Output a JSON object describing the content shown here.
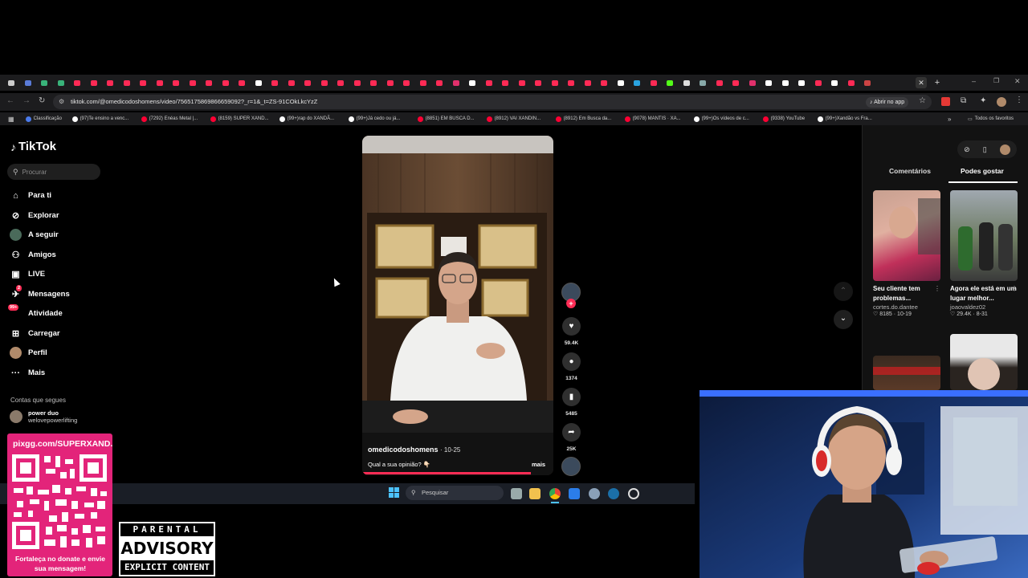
{
  "browser": {
    "url": "tiktok.com/@omedicodoshomens/video/7565175869866659092?_r=1&_t=ZS-91COkLkcYzZ",
    "open_in_app_label": "Abrir no app",
    "bookmarks": [
      {
        "label": "Classificação",
        "color": "#4b7bec"
      },
      {
        "label": "(97)Te ensino a venc...",
        "color": "#ffffff"
      },
      {
        "label": "(7292) Enéas Metal |...",
        "color": "#ff0033"
      },
      {
        "label": "(8159) SUPER XAND...",
        "color": "#ff0033"
      },
      {
        "label": "(99+)rap do XANDÃ...",
        "color": "#ffffff"
      },
      {
        "label": "(99+)Já cedo ou já...",
        "color": "#ffffff"
      },
      {
        "label": "(8851) EM BUSCA D...",
        "color": "#ff0033"
      },
      {
        "label": "(8912) VAI XANDIN...",
        "color": "#ff0033"
      },
      {
        "label": "(8912) Em Busca da...",
        "color": "#ff0033"
      },
      {
        "label": "(9078) MANTIS · XA...",
        "color": "#ff0033"
      },
      {
        "label": "(99+)Os vídeos de c...",
        "color": "#ffffff"
      },
      {
        "label": "(9338) YouTube",
        "color": "#ff0033"
      },
      {
        "label": "(99+)Xandão vs Fra...",
        "color": "#ffffff"
      }
    ],
    "all_favorites_label": "Todos os favoritos"
  },
  "tiktok": {
    "logo": "TikTok",
    "search_placeholder": "Procurar",
    "nav": [
      {
        "label": "Para ti",
        "icon": "home-icon"
      },
      {
        "label": "Explorar",
        "icon": "compass-icon"
      },
      {
        "label": "A seguir",
        "icon": "following-avatar-icon"
      },
      {
        "label": "Amigos",
        "icon": "friends-icon"
      },
      {
        "label": "LIVE",
        "icon": "live-icon"
      },
      {
        "label": "Mensagens",
        "icon": "messages-icon",
        "badge": "2"
      },
      {
        "label": "Atividade",
        "icon": "activity-icon",
        "badge": "99+"
      },
      {
        "label": "Carregar",
        "icon": "upload-icon"
      },
      {
        "label": "Perfil",
        "icon": "profile-avatar-icon"
      },
      {
        "label": "Mais",
        "icon": "more-icon"
      }
    ],
    "following_header": "Contas que segues",
    "following": [
      {
        "name": "power duo",
        "handle": "welovepowerlifting"
      }
    ],
    "video": {
      "author": "omedicodoshomens",
      "date": "10-25",
      "caption": "Qual a sua opinião? 👇🏻",
      "more_label": "mais",
      "likes": "59.4K",
      "comments": "1374",
      "saves": "5485",
      "shares": "25K"
    },
    "panel_tabs": [
      "Comentários",
      "Podes gostar"
    ],
    "suggestions": [
      {
        "title": "Seu cliente tem problemas...",
        "author": "cortes.do.dantee",
        "likes": "8185",
        "date": "10-19"
      },
      {
        "title": "Agora ele está em um lugar melhor...",
        "author": "joaovaldez02",
        "likes": "29.4K",
        "date": "8-31"
      }
    ]
  },
  "taskbar": {
    "search_placeholder": "Pesquisar"
  },
  "overlay": {
    "donate_url": "pixgg.com/SUPERXAND...",
    "donate_text": "Fortaleça no donate e envie sua mensagem!",
    "advisory_top": "PARENTAL",
    "advisory_main": "ADVISORY",
    "advisory_bottom": "EXPLICIT CONTENT"
  }
}
